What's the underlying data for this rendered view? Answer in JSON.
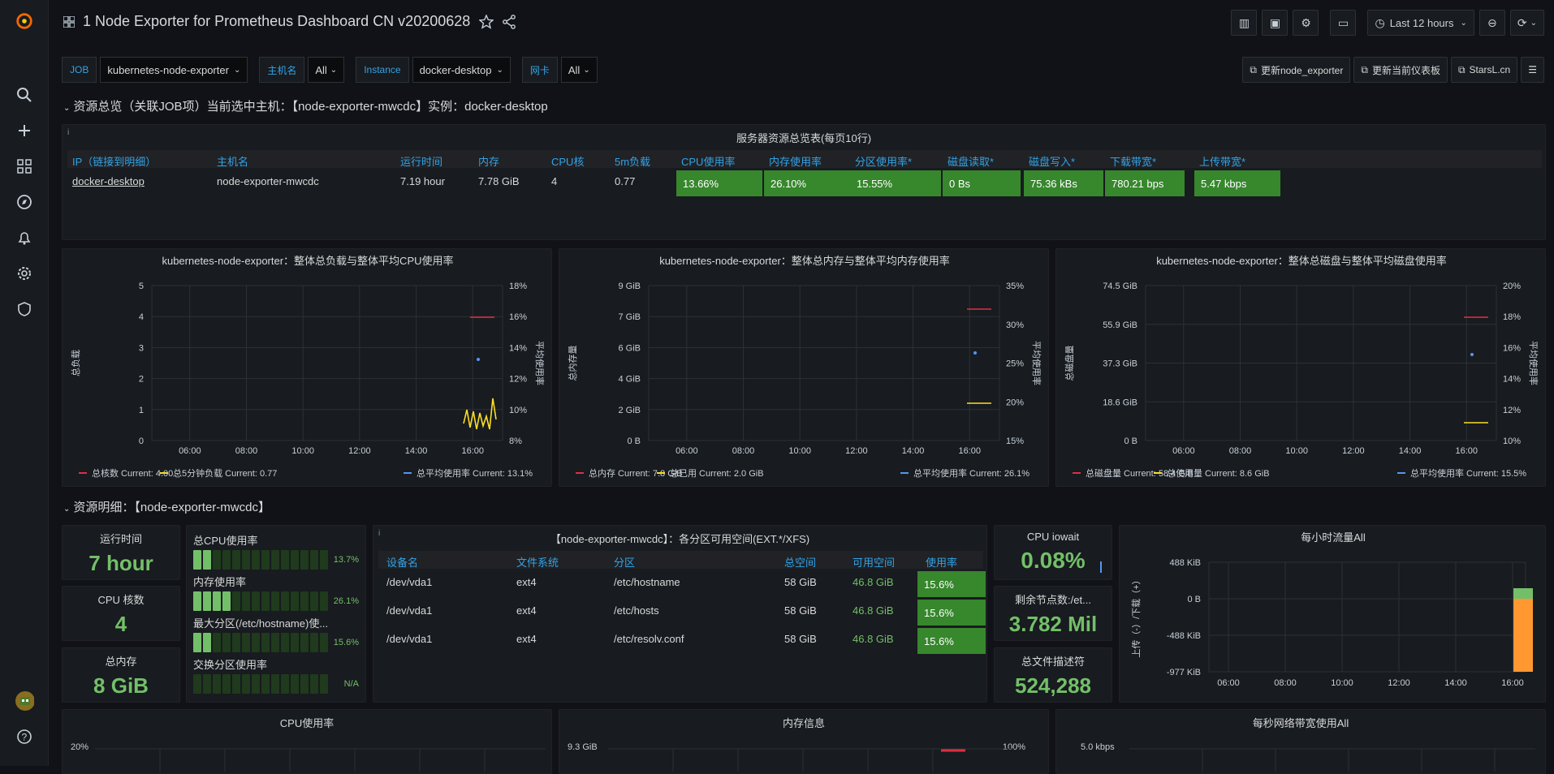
{
  "header": {
    "title": "1 Node Exporter for Prometheus Dashboard CN v20200628",
    "time_range": "Last 12 hours"
  },
  "vars": [
    {
      "label": "JOB",
      "value": "kubernetes-node-exporter"
    },
    {
      "label": "主机名",
      "value": "All"
    },
    {
      "label": "Instance",
      "value": "docker-desktop"
    },
    {
      "label": "网卡",
      "value": "All"
    }
  ],
  "links": [
    "更新node_exporter",
    "更新当前仪表板",
    "StarsL.cn"
  ],
  "rows": {
    "overview": "资源总览（关联JOB项）当前选中主机：【node-exporter-mwcdc】实例：docker-desktop",
    "detail": "资源明细：【node-exporter-mwcdc】"
  },
  "overview_table": {
    "title": "服务器资源总览表(每页10行)",
    "headers": [
      "IP（链接到明细）",
      "主机名",
      "运行时间",
      "内存",
      "CPU核",
      "5m负载",
      "CPU使用率",
      "内存使用率",
      "分区使用率*",
      "磁盘读取*",
      "磁盘写入*",
      "下载带宽*",
      "上传带宽*"
    ],
    "row": [
      "docker-desktop",
      "node-exporter-mwcdc",
      "7.19 hour",
      "7.78 GiB",
      "4",
      "0.77",
      "13.66%",
      "26.10%",
      "15.55%",
      "0 Bs",
      "75.36 kBs",
      "780.21 bps",
      "5.47 kbps"
    ]
  },
  "chart_data": [
    {
      "type": "line",
      "title": "kubernetes-node-exporter：整体总负载与整体平均CPU使用率",
      "ylabel": "总负载",
      "y2label": "平均使用率",
      "x": [
        "06:00",
        "08:00",
        "10:00",
        "12:00",
        "14:00",
        "16:00"
      ],
      "yticks": [
        "0",
        "1",
        "2",
        "3",
        "4",
        "5"
      ],
      "y2ticks": [
        "8%",
        "10%",
        "12%",
        "14%",
        "16%",
        "18%"
      ],
      "series": [
        {
          "name": "总核数",
          "current": "Current: 4.00",
          "color": "#e02f44"
        },
        {
          "name": "总5分钟负载",
          "current": "Current: 0.77",
          "color": "#fade2a"
        },
        {
          "name": "总平均使用率",
          "current": "Current: 13.1%",
          "color": "#5794f2"
        }
      ]
    },
    {
      "type": "line",
      "title": "kubernetes-node-exporter：整体总内存与整体平均内存使用率",
      "ylabel": "总内存量",
      "y2label": "平均使用率",
      "x": [
        "06:00",
        "08:00",
        "10:00",
        "12:00",
        "14:00",
        "16:00"
      ],
      "yticks": [
        "0 B",
        "2 GiB",
        "4 GiB",
        "6 GiB",
        "7 GiB",
        "9 GiB"
      ],
      "y2ticks": [
        "15%",
        "20%",
        "25%",
        "30%",
        "35%"
      ],
      "series": [
        {
          "name": "总内存",
          "current": "Current: 7.8 GiB",
          "color": "#e02f44"
        },
        {
          "name": "总已用",
          "current": "Current: 2.0 GiB",
          "color": "#fade2a"
        },
        {
          "name": "总平均使用率",
          "current": "Current: 26.1%",
          "color": "#5794f2"
        }
      ]
    },
    {
      "type": "line",
      "title": "kubernetes-node-exporter：整体总磁盘与整体平均磁盘使用率",
      "ylabel": "总磁盘量",
      "y2label": "平均使用率",
      "x": [
        "06:00",
        "08:00",
        "10:00",
        "12:00",
        "14:00",
        "16:00"
      ],
      "yticks": [
        "0 B",
        "18.6 GiB",
        "37.3 GiB",
        "55.9 GiB",
        "74.5 GiB"
      ],
      "y2ticks": [
        "10%",
        "12%",
        "14%",
        "16%",
        "18%",
        "20%"
      ],
      "series": [
        {
          "name": "总磁盘量",
          "current": "Current: 58.4 GiB",
          "color": "#e02f44"
        },
        {
          "name": "总使用量",
          "current": "Current: 8.6 GiB",
          "color": "#fade2a"
        },
        {
          "name": "总平均使用率",
          "current": "Current: 15.5%",
          "color": "#5794f2"
        }
      ]
    }
  ],
  "stats": {
    "uptime_label": "运行时间",
    "uptime": "7 hour",
    "cores_label": "CPU 核数",
    "cores": "4",
    "mem_label": "总内存",
    "mem": "8 GiB",
    "iowait_label": "CPU iowait",
    "iowait": "0.08%",
    "nodes_label": "剩余节点数:/et...",
    "nodes": "3.782 Mil",
    "fd_label": "总文件描述符",
    "fd": "524,288"
  },
  "gauges": [
    {
      "label": "总CPU使用率",
      "value": "13.7%",
      "level": 0.137
    },
    {
      "label": "内存使用率",
      "value": "26.1%",
      "level": 0.261
    },
    {
      "label": "最大分区(/etc/hostname)使...",
      "value": "15.6%",
      "level": 0.156
    },
    {
      "label": "交换分区使用率",
      "value": "N/A",
      "level": 0
    }
  ],
  "fs_table": {
    "title": "【node-exporter-mwcdc】：各分区可用空间(EXT.*/XFS)",
    "headers": [
      "设备名",
      "文件系统",
      "分区",
      "总空间",
      "可用空间",
      "使用率"
    ],
    "rows": [
      [
        "/dev/vda1",
        "ext4",
        "/etc/hostname",
        "58 GiB",
        "46.8 GiB",
        "15.6%"
      ],
      [
        "/dev/vda1",
        "ext4",
        "/etc/hosts",
        "58 GiB",
        "46.8 GiB",
        "15.6%"
      ],
      [
        "/dev/vda1",
        "ext4",
        "/etc/resolv.conf",
        "58 GiB",
        "46.8 GiB",
        "15.6%"
      ]
    ]
  },
  "traffic": {
    "title": "每小时流量All",
    "ylabel": "上传（-）/下载（+）",
    "yticks": [
      "488 KiB",
      "0 B",
      "-488 KiB",
      "-977 KiB"
    ],
    "x": [
      "06:00",
      "08:00",
      "10:00",
      "12:00",
      "14:00",
      "16:00"
    ]
  },
  "bottom": {
    "cpu_title": "CPU使用率",
    "cpu_tick": "20%",
    "mem_title": "内存信息",
    "mem_tick": "9.3 GiB",
    "mem_tick2": "100%",
    "net_title": "每秒网络带宽使用All",
    "net_tick": "5.0 kbps"
  }
}
